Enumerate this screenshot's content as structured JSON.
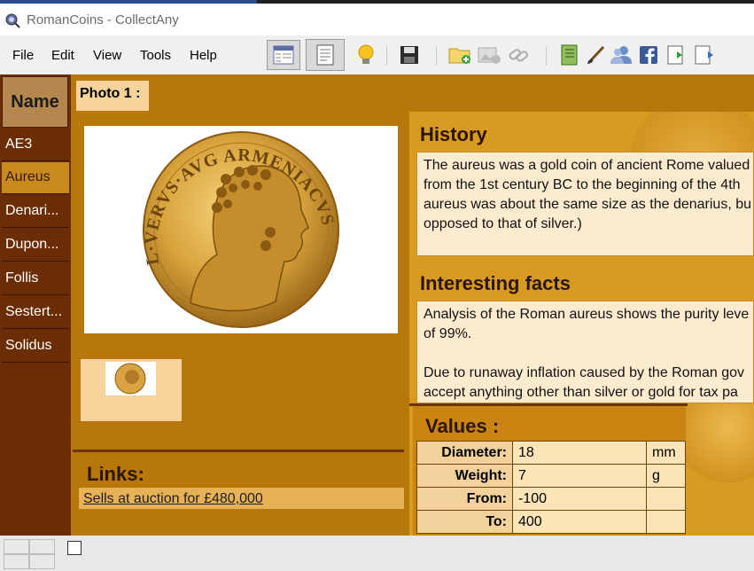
{
  "window": {
    "title": "RomanCoins - CollectAny"
  },
  "menu": [
    "File",
    "Edit",
    "View",
    "Tools",
    "Help"
  ],
  "toolbar": {
    "icons": [
      "table-view-icon",
      "card-view-icon",
      "lightbulb-icon",
      "save-icon",
      "new-item-icon",
      "add-image-icon",
      "link-icon",
      "notebook-icon",
      "paintbrush-icon",
      "users-icon",
      "facebook-icon",
      "import-icon",
      "export-icon"
    ]
  },
  "list": {
    "header": "Name",
    "items": [
      "AE3",
      "Aureus",
      "Denari...",
      "Dupon...",
      "Follis",
      "Sestert...",
      "Solidus"
    ],
    "selected": "Aureus"
  },
  "photo": {
    "label": "Photo 1 :",
    "legend": "L·VERVS·AVG ARMENIACVS"
  },
  "links": {
    "title": "Links:",
    "item": "Sells at auction for £480,000"
  },
  "history": {
    "title": "History",
    "lines": [
      "The aureus was a gold coin of ancient Rome valued",
      "from the 1st century BC to the beginning of the 4th",
      "aureus was about the same size as the denarius, bu",
      "opposed to that of silver.)"
    ]
  },
  "facts": {
    "title": "Interesting facts",
    "lines": [
      "Analysis of the Roman aureus shows the purity leve",
      "of 99%.",
      "",
      "Due to runaway inflation caused by the Roman gov",
      "accept anything other than silver or gold for tax pa"
    ]
  },
  "values": {
    "title": "Values :",
    "rows": [
      {
        "label": "Diameter:",
        "value": "18",
        "unit": "mm"
      },
      {
        "label": "Weight:",
        "value": "7",
        "unit": "g"
      },
      {
        "label": "From:",
        "value": "-100",
        "unit": ""
      },
      {
        "label": "To:",
        "value": "400",
        "unit": ""
      }
    ]
  },
  "colors": {
    "background": "#b7770b",
    "list_bg": "#6a2d05",
    "selected": "#c88a1d",
    "text_box": "#fdebd0"
  }
}
